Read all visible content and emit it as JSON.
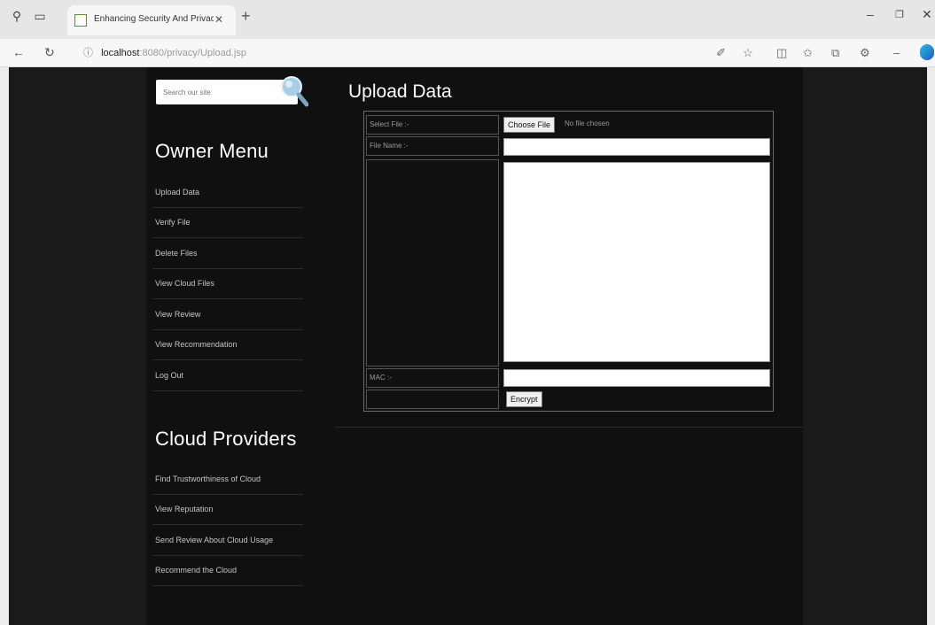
{
  "browser": {
    "tab_title": "Enhancing Security And Privacy",
    "url_host": "localhost",
    "url_path": ":8080/privacy/Upload.jsp"
  },
  "search": {
    "placeholder": "Search our site"
  },
  "owner_menu": {
    "title": "Owner Menu",
    "items": [
      {
        "label": "Upload Data"
      },
      {
        "label": "Verify File"
      },
      {
        "label": "Delete Files"
      },
      {
        "label": "View Cloud Files"
      },
      {
        "label": "View Review"
      },
      {
        "label": "View Recommendation"
      },
      {
        "label": "Log Out"
      }
    ]
  },
  "cloud_providers": {
    "title": "Cloud Providers",
    "items": [
      {
        "label": "Find Trustworthiness of Cloud"
      },
      {
        "label": "View Reputation"
      },
      {
        "label": "Send Review About Cloud Usage"
      },
      {
        "label": "Recommend the Cloud"
      }
    ]
  },
  "main": {
    "title": "Upload Data",
    "form": {
      "select_file_label": "Select File :-",
      "choose_file_button": "Choose File",
      "no_file_text": "No file chosen",
      "file_name_label": "File Name :-",
      "mac_label": "MAC :-",
      "encrypt_button": "Encrypt"
    }
  },
  "icons": {
    "back": "back-arrow-icon",
    "refresh": "refresh-icon",
    "info": "info-icon",
    "search": "search-magnifier-icon"
  }
}
